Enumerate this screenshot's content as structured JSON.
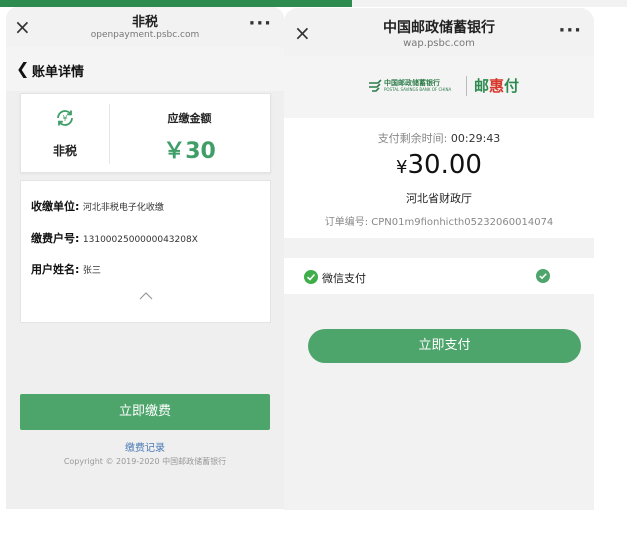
{
  "left": {
    "title": "非税",
    "url": "openpayment.psbc.com",
    "page_title": "账单详情",
    "tax_label": "非税",
    "due_label": "应缴金额",
    "due_value": "￥30",
    "info": {
      "unit_key": "收缴单位:",
      "unit_value": "河北非税电子化收缴",
      "account_key": "缴费户号:",
      "account_value": "1310002500000043208X",
      "name_key": "用户姓名:",
      "name_value": "张三"
    },
    "pay_button": "立即缴费",
    "records_link": "缴费记录",
    "copyright": "Copyright © 2019-2020 中国邮政储蓄银行"
  },
  "right": {
    "title": "中国邮政储蓄银行",
    "url": "wap.psbc.com",
    "bank_name_cn": "中国邮政储蓄银行",
    "bank_name_en": "POSTAL SAVINGS BANK OF CHINA",
    "brand_pre": "邮",
    "brand_hui": "惠",
    "brand_post": "付",
    "remaining_label": "支付剩余时间:",
    "remaining_time": "00:29:43",
    "currency": "¥",
    "amount": "30.00",
    "payee": "河北省财政厅",
    "order_label": "订单编号:",
    "order_no": "CPN01m9fionhicth05232060014074",
    "wechat_label": "微信支付",
    "pay_button": "立即支付"
  },
  "icons": {
    "close": "×",
    "more": "···",
    "back": "❮",
    "caret": "︿"
  },
  "colors": {
    "accent_green": "#4da56b",
    "amount_green": "#3f9e67",
    "psbc_green": "#2e8b50"
  }
}
